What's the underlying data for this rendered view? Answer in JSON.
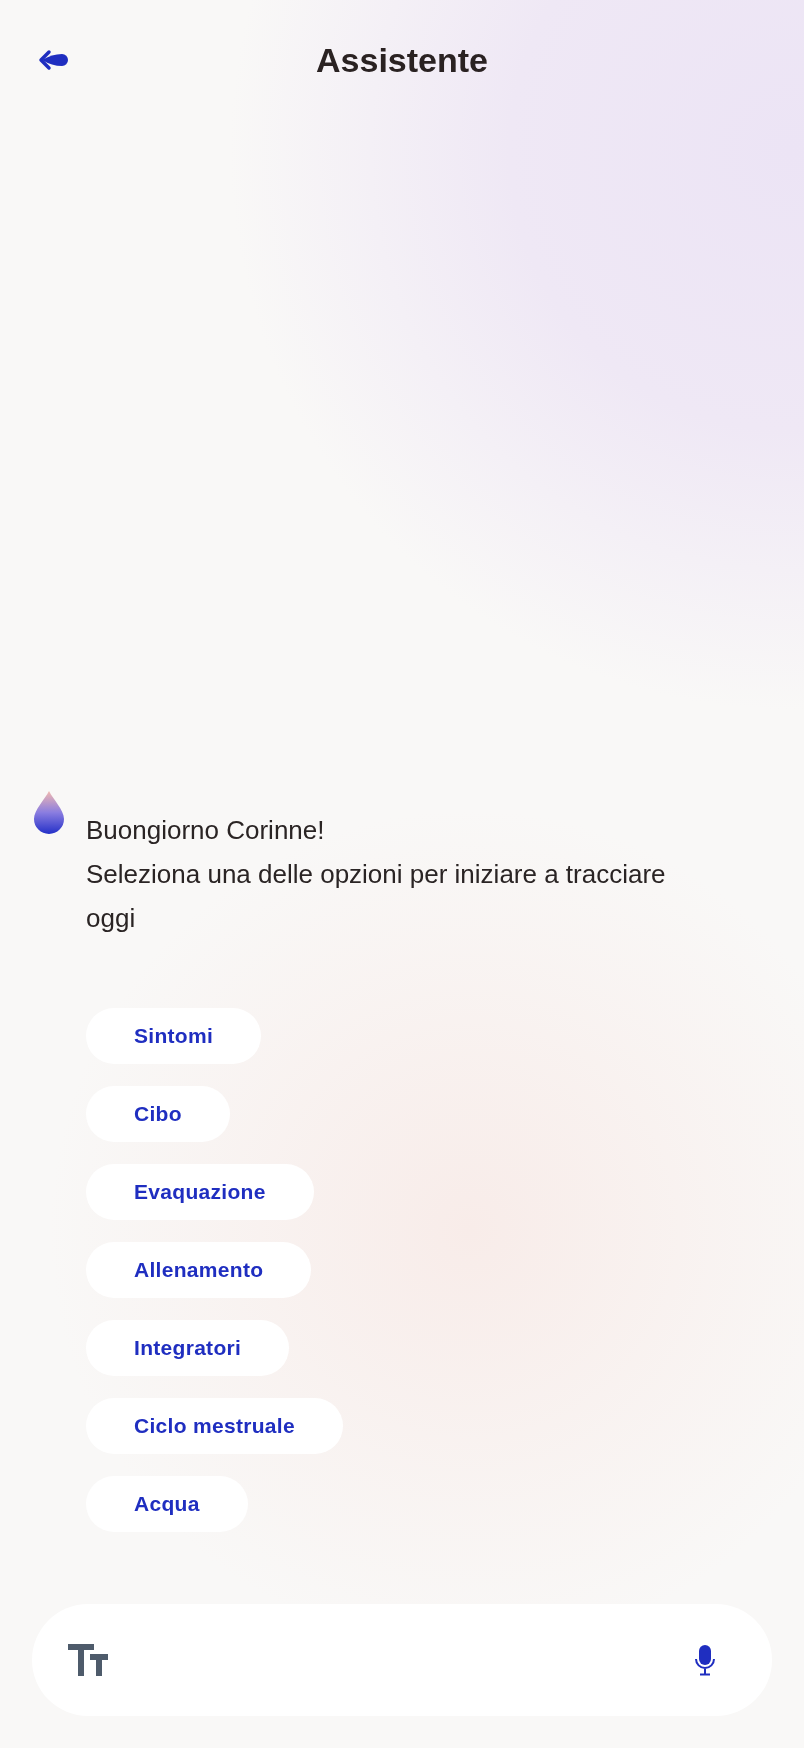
{
  "header": {
    "title": "Assistente"
  },
  "message": {
    "greeting": "Buongiorno Corinne!",
    "prompt": "Seleziona una delle opzioni per iniziare a tracciare oggi"
  },
  "options": [
    {
      "label": "Sintomi"
    },
    {
      "label": "Cibo"
    },
    {
      "label": "Evaquazione"
    },
    {
      "label": "Allenamento"
    },
    {
      "label": "Integratori"
    },
    {
      "label": "Ciclo mestruale"
    },
    {
      "label": "Acqua"
    }
  ]
}
